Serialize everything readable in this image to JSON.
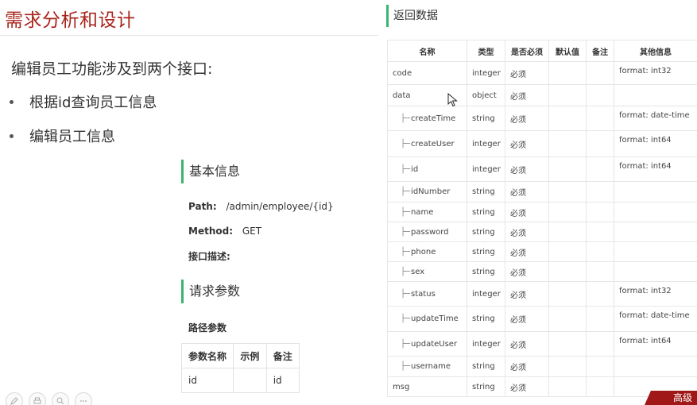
{
  "slide": {
    "title": "需求分析和设计",
    "intro": "编辑员工功能涉及到两个接口:",
    "bullets": [
      "根据id查询员工信息",
      "编辑员工信息"
    ]
  },
  "basic_info": {
    "heading": "基本信息",
    "path_label": "Path:",
    "path_value": "/admin/employee/{id}",
    "method_label": "Method:",
    "method_value": "GET",
    "desc_label": "接口描述:"
  },
  "request_params": {
    "heading": "请求参数",
    "sub_label": "路径参数",
    "columns": [
      "参数名称",
      "示例",
      "备注"
    ],
    "rows": [
      [
        "id",
        "",
        "id"
      ]
    ]
  },
  "response": {
    "heading": "返回数据",
    "columns": [
      "名称",
      "类型",
      "是否必须",
      "默认值",
      "备注",
      "其他信息"
    ],
    "rows": [
      {
        "name": "code",
        "child": false,
        "type": "integer",
        "required": "必须",
        "default": "",
        "remark": "",
        "other": "format: int32"
      },
      {
        "name": "data",
        "child": false,
        "type": "object",
        "required": "必须",
        "default": "",
        "remark": "",
        "other": ""
      },
      {
        "name": "createTime",
        "child": true,
        "type": "string",
        "required": "必须",
        "default": "",
        "remark": "",
        "other": "format: date-time"
      },
      {
        "name": "createUser",
        "child": true,
        "type": "integer",
        "required": "必须",
        "default": "",
        "remark": "",
        "other": "format: int64"
      },
      {
        "name": "id",
        "child": true,
        "type": "integer",
        "required": "必须",
        "default": "",
        "remark": "",
        "other": "format: int64"
      },
      {
        "name": "idNumber",
        "child": true,
        "type": "string",
        "required": "必须",
        "default": "",
        "remark": "",
        "other": ""
      },
      {
        "name": "name",
        "child": true,
        "type": "string",
        "required": "必须",
        "default": "",
        "remark": "",
        "other": ""
      },
      {
        "name": "password",
        "child": true,
        "type": "string",
        "required": "必须",
        "default": "",
        "remark": "",
        "other": ""
      },
      {
        "name": "phone",
        "child": true,
        "type": "string",
        "required": "必须",
        "default": "",
        "remark": "",
        "other": ""
      },
      {
        "name": "sex",
        "child": true,
        "type": "string",
        "required": "必须",
        "default": "",
        "remark": "",
        "other": ""
      },
      {
        "name": "status",
        "child": true,
        "type": "integer",
        "required": "必须",
        "default": "",
        "remark": "",
        "other": "format: int32"
      },
      {
        "name": "updateTime",
        "child": true,
        "type": "string",
        "required": "必须",
        "default": "",
        "remark": "",
        "other": "format: date-time"
      },
      {
        "name": "updateUser",
        "child": true,
        "type": "integer",
        "required": "必须",
        "default": "",
        "remark": "",
        "other": "format: int64"
      },
      {
        "name": "username",
        "child": true,
        "type": "string",
        "required": "必须",
        "default": "",
        "remark": "",
        "other": ""
      },
      {
        "name": "msg",
        "child": false,
        "type": "string",
        "required": "必须",
        "default": "",
        "remark": "",
        "other": ""
      }
    ]
  },
  "toolbar": {
    "icons": [
      "pen-icon",
      "print-icon",
      "search-icon",
      "more-icon"
    ]
  },
  "badge": {
    "text": "高级"
  },
  "colors": {
    "title": "#a8251c",
    "accent_bar": "#3cb371",
    "badge": "#a01818"
  }
}
